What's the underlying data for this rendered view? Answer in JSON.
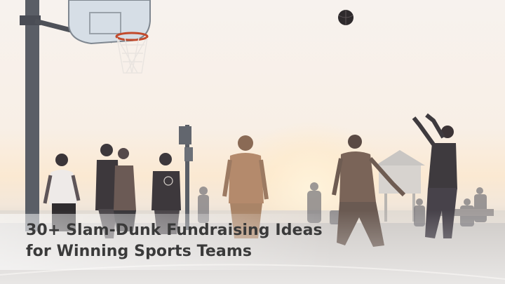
{
  "headline": {
    "line1": "30+ Slam-Dunk Fundraising Ideas",
    "line2": "for Winning Sports Teams"
  },
  "colors": {
    "title_text": "#3a3a3a",
    "silhouette": "#4b4b52",
    "sky": "#f7f2ee"
  }
}
